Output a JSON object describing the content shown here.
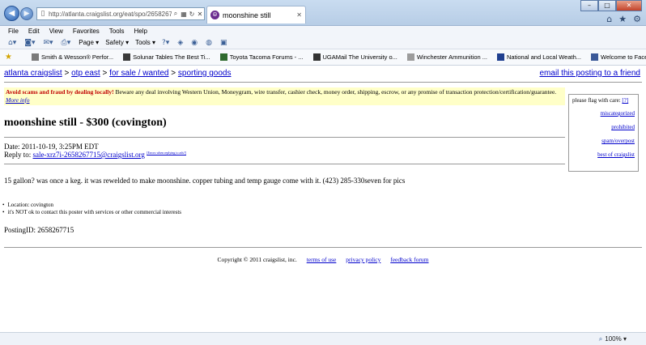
{
  "browser": {
    "address_url": "http://atlanta.craigslist.org/eat/spo/2658267715.htr",
    "tab_title": "moonshine still",
    "menu": [
      "File",
      "Edit",
      "View",
      "Favorites",
      "Tools",
      "Help"
    ],
    "commands": [
      "Page ▾",
      "Safety ▾",
      "Tools ▾"
    ],
    "favorites": [
      {
        "label": "Smith & Wesson® Perfor...",
        "color": "#7a7a7a"
      },
      {
        "label": "Solunar Tables The Best Ti...",
        "color": "#3a3a3a"
      },
      {
        "label": "Toyota Tacoma Forums - ...",
        "color": "#2f6a2f"
      },
      {
        "label": "UGAMail The University o...",
        "color": "#333333"
      },
      {
        "label": "Winchester Ammunition ...",
        "color": "#9c9c9c"
      },
      {
        "label": "National and Local Weath...",
        "color": "#1f3f8f"
      },
      {
        "label": "Welcome to Facebook - L...",
        "color": "#3b5998"
      }
    ],
    "zoom": "100%"
  },
  "page": {
    "breadcrumbs": [
      "atlanta craigslist",
      "otp east",
      "for sale / wanted",
      "sporting goods"
    ],
    "email_link": "email this posting to a friend",
    "warning": {
      "bold": "Avoid scams and fraud by dealing locally!",
      "text": " Beware any deal involving Western Union, Moneygram, wire transfer, cashier check, money order, shipping, escrow, or any promise of transaction protection/certification/guarantee. ",
      "more": "More info"
    },
    "flag": {
      "head": "please flag with care:",
      "help": "[?]",
      "options": [
        "miscategorized",
        "prohibited",
        "spam/overpost",
        "best of craigslist"
      ]
    },
    "title": "moonshine still - $300 (covington)",
    "date": "Date: 2011-10-19, 3:25PM EDT",
    "reply_label": "Reply to: ",
    "reply_email": "sale-xrz7i-2658267715@craigslist.org",
    "reply_tip": "[Errors when replying to ads?]",
    "body": "15 gallon? was once a keg. it was rewelded to make moonshine. copper tubing and temp gauge come with it. (423) 285-330seven for pics",
    "bullets": [
      "Location: covington",
      "it's NOT ok to contact this poster with services or other commercial interests"
    ],
    "posting_id": "PostingID: 2658267715",
    "footer": {
      "copyright": "Copyright © 2011 craigslist, inc.",
      "links": [
        "terms of use",
        "privacy policy",
        "feedback forum"
      ]
    }
  }
}
